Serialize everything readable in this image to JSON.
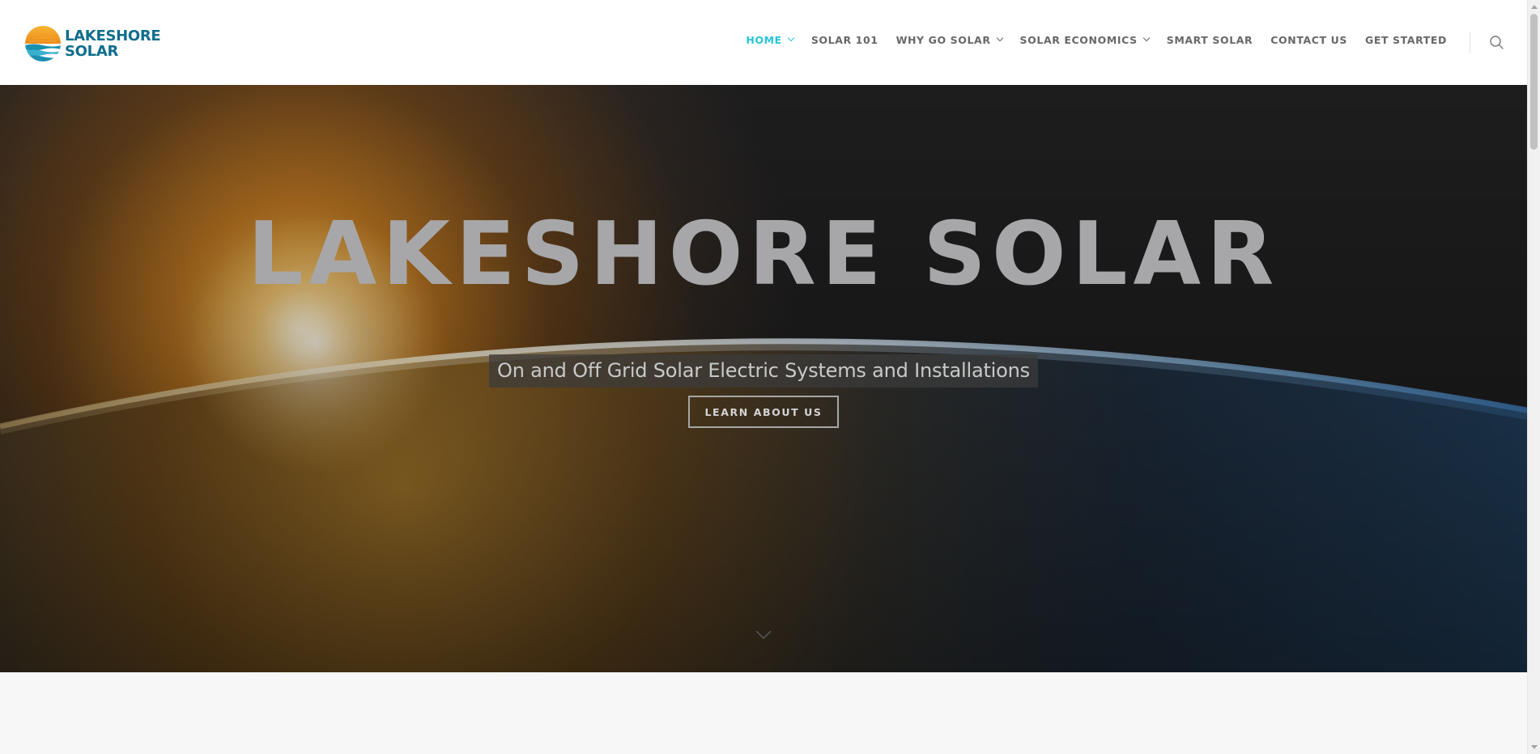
{
  "brand": {
    "name_line1": "LAKESHORE",
    "name_line2": "SOLAR",
    "logo_icon": "sun-over-water-logo",
    "colors": {
      "logo_sun": "#f29a1f",
      "logo_water": "#1a8fb0",
      "logo_text": "#0f6e8c"
    }
  },
  "nav": {
    "items": [
      {
        "label": "HOME",
        "active": true,
        "has_dropdown": true
      },
      {
        "label": "SOLAR 101",
        "active": false,
        "has_dropdown": false
      },
      {
        "label": "WHY GO SOLAR",
        "active": false,
        "has_dropdown": true
      },
      {
        "label": "SOLAR ECONOMICS",
        "active": false,
        "has_dropdown": true
      },
      {
        "label": "SMART SOLAR",
        "active": false,
        "has_dropdown": false
      },
      {
        "label": "CONTACT US",
        "active": false,
        "has_dropdown": false
      },
      {
        "label": "GET STARTED",
        "active": false,
        "has_dropdown": false
      }
    ],
    "search_icon": "search-icon",
    "chevron_icon": "chevron-down-icon",
    "active_color": "#27c4dc",
    "text_color": "#676767"
  },
  "hero": {
    "title": "LAKESHORE SOLAR",
    "subtitle": "On and Off Grid Solar Electric Systems and Installations",
    "cta_label": "LEARN ABOUT US",
    "scroll_icon": "chevron-down-icon",
    "background": "sunrise-over-earth-from-space"
  }
}
